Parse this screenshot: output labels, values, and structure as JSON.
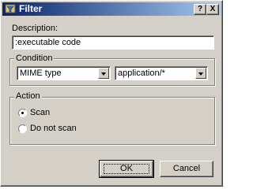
{
  "window": {
    "title": "Filter",
    "icon": "filter-icon",
    "help_label": "?",
    "close_label": "X"
  },
  "description": {
    "label": "Description:",
    "value": ":executable code"
  },
  "condition": {
    "legend": "Condition",
    "type_value": "MIME type",
    "pattern_value": "application/*"
  },
  "action": {
    "legend": "Action",
    "options": [
      {
        "label": "Scan",
        "selected": true
      },
      {
        "label": "Do not scan",
        "selected": false
      }
    ]
  },
  "buttons": {
    "ok": "OK",
    "cancel": "Cancel"
  }
}
